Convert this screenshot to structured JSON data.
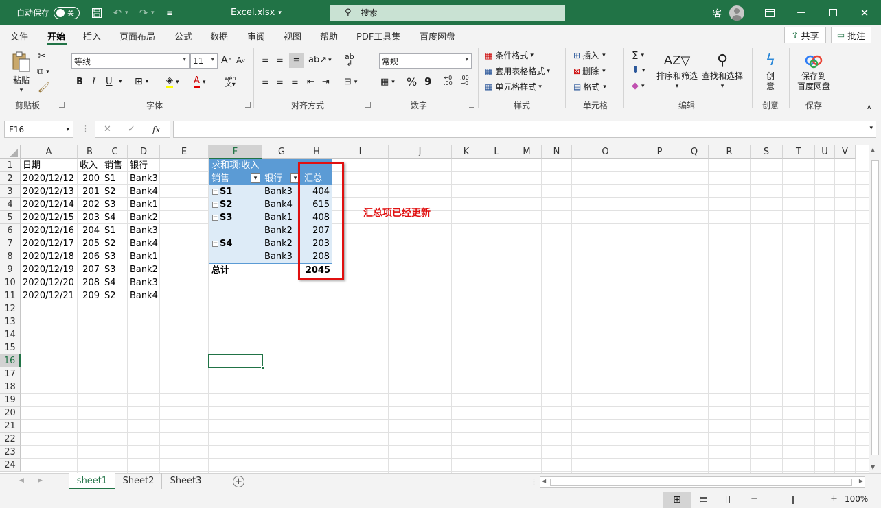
{
  "titlebar": {
    "autosave_label": "自动保存",
    "autosave_state": "关",
    "filename": "Excel.xlsx",
    "search_label": "搜索",
    "user_glyph": "客"
  },
  "menu": [
    "文件",
    "开始",
    "插入",
    "页面布局",
    "公式",
    "数据",
    "审阅",
    "视图",
    "帮助",
    "PDF工具集",
    "百度网盘"
  ],
  "topbuttons": {
    "share": "共享",
    "comment": "批注"
  },
  "ribbon": {
    "clipboard": {
      "paste": "粘贴",
      "group": "剪贴板"
    },
    "font": {
      "name": "等线",
      "size": "11",
      "grow": "A",
      "shrink": "A",
      "bold": "B",
      "italic": "I",
      "underline": "U",
      "group": "字体",
      "phonetic": "wén"
    },
    "align": {
      "group": "对齐方式"
    },
    "number": {
      "format": "常规",
      "percent": "%",
      "comma": "9",
      "group": "数字"
    },
    "styles": {
      "cond": "条件格式",
      "table": "套用表格格式",
      "cell": "单元格样式",
      "group": "样式"
    },
    "cells": {
      "insert": "插入",
      "delete": "删除",
      "format": "格式",
      "group": "单元格"
    },
    "editing": {
      "sort": "排序和筛选",
      "find": "查找和选择",
      "group": "编辑"
    },
    "idea": {
      "line1": "创",
      "line2": "意",
      "group": "创意"
    },
    "save": {
      "line1": "保存到",
      "line2": "百度网盘",
      "group": "保存"
    }
  },
  "formula": {
    "cell_ref": "F16",
    "fx": "fx",
    "value": ""
  },
  "columns": [
    "A",
    "B",
    "C",
    "D",
    "E",
    "F",
    "G",
    "H",
    "I",
    "J",
    "K",
    "L",
    "M",
    "N",
    "O",
    "P",
    "Q",
    "R",
    "S",
    "T",
    "U",
    "V"
  ],
  "rows": [
    "1",
    "2",
    "3",
    "4",
    "5",
    "6",
    "7",
    "8",
    "9",
    "10",
    "11",
    "12",
    "13",
    "14",
    "15",
    "16",
    "17",
    "18",
    "19",
    "20",
    "21",
    "22",
    "23",
    "24"
  ],
  "data_headers": [
    "日期",
    "收入",
    "销售",
    "银行"
  ],
  "data_rows": [
    [
      "2020/12/12",
      "200",
      "S1",
      "Bank3"
    ],
    [
      "2020/12/13",
      "201",
      "S2",
      "Bank4"
    ],
    [
      "2020/12/14",
      "202",
      "S3",
      "Bank1"
    ],
    [
      "2020/12/15",
      "203",
      "S4",
      "Bank2"
    ],
    [
      "2020/12/16",
      "204",
      "S1",
      "Bank3"
    ],
    [
      "2020/12/17",
      "205",
      "S2",
      "Bank4"
    ],
    [
      "2020/12/18",
      "206",
      "S3",
      "Bank1"
    ],
    [
      "2020/12/19",
      "207",
      "S3",
      "Bank2"
    ],
    [
      "2020/12/20",
      "208",
      "S4",
      "Bank3"
    ],
    [
      "2020/12/21",
      "209",
      "S2",
      "Bank4"
    ]
  ],
  "pivot": {
    "title": "求和项:收入",
    "header_sales": "销售",
    "header_bank": "银行",
    "header_total": "汇总",
    "rows": [
      {
        "sales": "S1",
        "bank": "Bank3",
        "value": "404"
      },
      {
        "sales": "S2",
        "bank": "Bank4",
        "value": "615"
      },
      {
        "sales": "S3",
        "bank": "Bank1",
        "value": "408"
      },
      {
        "sales": "",
        "bank": "Bank2",
        "value": "207"
      },
      {
        "sales": "S4",
        "bank": "Bank2",
        "value": "203"
      },
      {
        "sales": "",
        "bank": "Bank3",
        "value": "208"
      }
    ],
    "grand_label": "总计",
    "grand_value": "2045"
  },
  "annotation": "汇总项已经更新",
  "sheets": [
    "sheet1",
    "Sheet2",
    "Sheet3"
  ],
  "status": {
    "zoom": "100%"
  },
  "colors": {
    "excel_green": "#217346",
    "pivot_blue": "#5b9bd5",
    "pivot_light": "#ddebf7",
    "annotation_red": "#e01010"
  }
}
